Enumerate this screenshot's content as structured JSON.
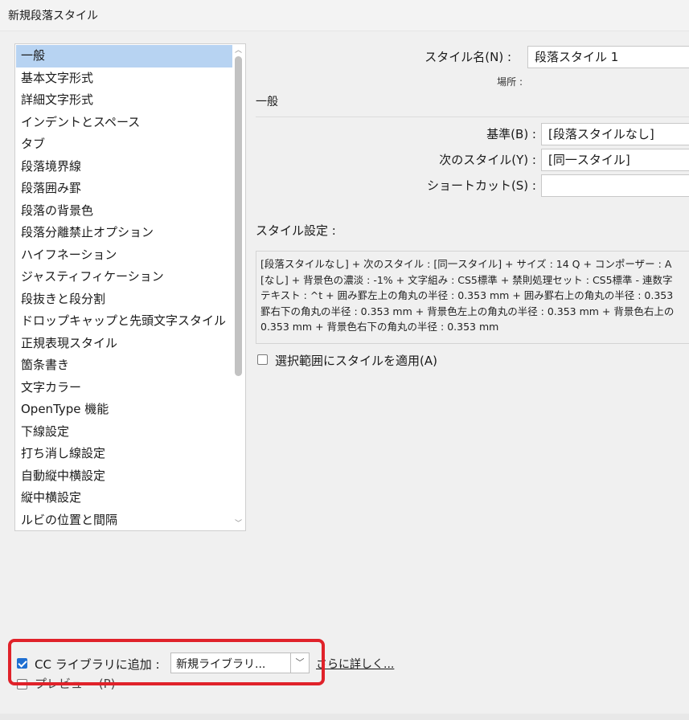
{
  "window": {
    "title": "新規段落スタイル"
  },
  "categories": [
    {
      "label": "一般",
      "selected": true
    },
    {
      "label": "基本文字形式"
    },
    {
      "label": "詳細文字形式"
    },
    {
      "label": "インデントとスペース"
    },
    {
      "label": "タブ"
    },
    {
      "label": "段落境界線"
    },
    {
      "label": "段落囲み罫"
    },
    {
      "label": "段落の背景色"
    },
    {
      "label": "段落分離禁止オプション"
    },
    {
      "label": "ハイフネーション"
    },
    {
      "label": "ジャスティフィケーション"
    },
    {
      "label": "段抜きと段分割"
    },
    {
      "label": "ドロップキャップと先頭文字スタイル"
    },
    {
      "label": "正規表現スタイル"
    },
    {
      "label": "箇条書き"
    },
    {
      "label": "文字カラー"
    },
    {
      "label": "OpenType 機能"
    },
    {
      "label": "下線設定"
    },
    {
      "label": "打ち消し線設定"
    },
    {
      "label": "自動縦中横設定"
    },
    {
      "label": "縦中横設定"
    },
    {
      "label": "ルビの位置と間隔"
    }
  ],
  "style_name": {
    "label": "スタイル名(N) :",
    "value": "段落スタイル 1"
  },
  "location": {
    "label": "場所 :"
  },
  "section": {
    "title": "一般"
  },
  "based_on": {
    "label": "基準(B) :",
    "value": "[段落スタイルなし]"
  },
  "next_style": {
    "label": "次のスタイル(Y) :",
    "value": "[同一スタイル]"
  },
  "shortcut": {
    "label": "ショートカット(S) :",
    "value": ""
  },
  "style_settings": {
    "label": "スタイル設定 :",
    "lines": [
      "[段落スタイルなし] + 次のスタイル : [同一スタイル] + サイズ : 14 Q + コンポーザー : A",
      "[なし] + 背景色の濃淡 : -1% + 文字組み : CS5標準 + 禁則処理セット : CS5標準 - 連数字",
      "テキスト : ^t + 囲み罫左上の角丸の半径 : 0.353 mm + 囲み罫右上の角丸の半径 : 0.353",
      "罫右下の角丸の半径 : 0.353 mm + 背景色左上の角丸の半径 : 0.353 mm + 背景色右上の",
      "0.353 mm + 背景色右下の角丸の半径 : 0.353 mm"
    ]
  },
  "apply_to_selection": {
    "label": "選択範囲にスタイルを適用(A)",
    "checked": false
  },
  "cc_library": {
    "label": "CC ライブラリに追加 :",
    "checked": true,
    "selected": "新規ライブラリ...",
    "link": "さらに詳しく..."
  },
  "preview": {
    "label": "プレビュー (P)",
    "checked": false
  },
  "colors": {
    "accent": "#1f6fd1",
    "selection": "#b7d3f2",
    "highlight": "#e0222a"
  }
}
